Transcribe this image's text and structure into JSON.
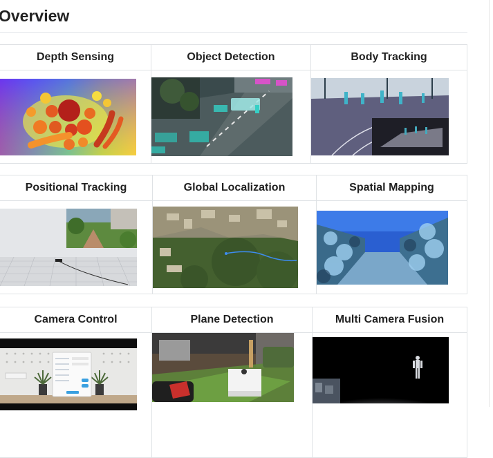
{
  "page": {
    "title": "Overview"
  },
  "tables": [
    {
      "headers": [
        "Depth Sensing",
        "Object Detection",
        "Body Tracking"
      ]
    },
    {
      "headers": [
        "Positional Tracking",
        "Global Localization",
        "Spatial Mapping"
      ]
    },
    {
      "headers": [
        "Camera Control",
        "Plane Detection",
        "Multi Camera Fusion"
      ]
    }
  ]
}
